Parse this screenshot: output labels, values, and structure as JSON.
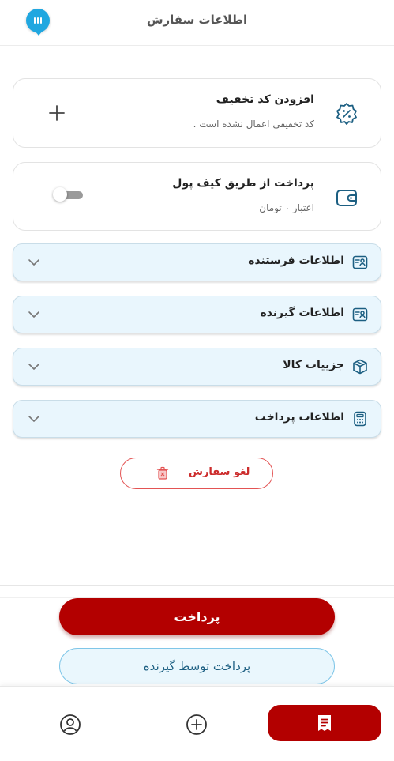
{
  "header": {
    "title": "اطلاعات سفارش"
  },
  "discount": {
    "title": "افزودن کد تخفیف",
    "subtitle": "کد تخفیفی اعمال نشده است ."
  },
  "wallet": {
    "title": "پرداخت از طریق کیف پول",
    "balance": "اعتبار ۰ تومان",
    "enabled": false
  },
  "sections": [
    {
      "label": "اطلاعات فرستنده",
      "icon": "id-card-icon"
    },
    {
      "label": "اطلاعات گیرنده",
      "icon": "id-card-icon"
    },
    {
      "label": "جزییات کالا",
      "icon": "package-icon"
    },
    {
      "label": "اطلاعات پرداخت",
      "icon": "calculator-icon"
    }
  ],
  "cancel": {
    "label": "لغو سفارش"
  },
  "actions": {
    "pay": "پرداخت",
    "pay_by_receiver": "پرداخت توسط گیرنده"
  },
  "colors": {
    "primary": "#b30000",
    "accent": "#20a7e0",
    "section_bg": "#e9f6fd",
    "cancel": "#e35353"
  }
}
